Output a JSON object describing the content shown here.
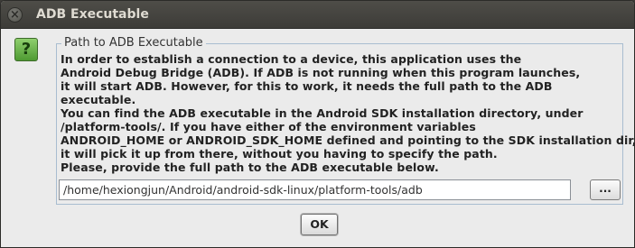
{
  "window": {
    "title": "ADB Executable",
    "close_glyph": "×"
  },
  "dialog": {
    "icon": "question-icon",
    "icon_glyph": "?",
    "group_title": "Path to ADB Executable",
    "message_lines": [
      "In order to establish a connection to a device, this application uses the",
      "Android Debug Bridge (ADB). If ADB is not running when this program launches,",
      "it will start ADB. However, for this to work, it needs the full path to the ADB",
      "executable.",
      "You can find the ADB executable in the Android SDK installation directory, under",
      "/platform-tools/. If you have either of the environment variables",
      "ANDROID_HOME or ANDROID_SDK_HOME defined and pointing to the SDK installation dir,",
      "it will pick it up from there, without you having to specify the path.",
      "Please, provide the full path to the ADB executable below."
    ],
    "path_value": "/home/hexiongjun/Android/android-sdk-linux/platform-tools/adb",
    "browse_label": "...",
    "ok_label": "OK"
  },
  "colors": {
    "titlebar": "#3d3c38",
    "dialog_bg": "#ebebeb",
    "group_border": "#a9bdd0",
    "icon_green": "#4e9a32"
  }
}
